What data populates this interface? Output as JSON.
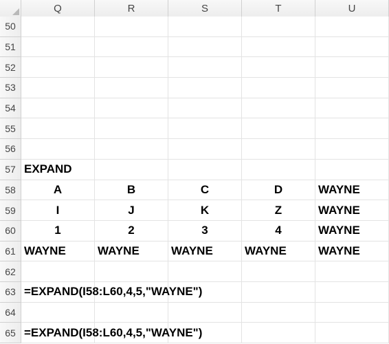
{
  "columns": [
    "Q",
    "R",
    "S",
    "T",
    "U"
  ],
  "row_start": 50,
  "row_end": 65,
  "row_height": 29.7,
  "chart_data": {
    "type": "table",
    "title": "",
    "cells": {
      "Q57": {
        "v": "EXPAND",
        "bold": true,
        "align": "left"
      },
      "Q58": {
        "v": "A",
        "bold": true,
        "align": "center"
      },
      "R58": {
        "v": "B",
        "bold": true,
        "align": "center"
      },
      "S58": {
        "v": "C",
        "bold": true,
        "align": "center"
      },
      "T58": {
        "v": "D",
        "bold": true,
        "align": "center"
      },
      "U58": {
        "v": "WAYNE",
        "bold": true,
        "align": "left"
      },
      "Q59": {
        "v": "I",
        "bold": true,
        "align": "center"
      },
      "R59": {
        "v": "J",
        "bold": true,
        "align": "center"
      },
      "S59": {
        "v": "K",
        "bold": true,
        "align": "center"
      },
      "T59": {
        "v": "Z",
        "bold": true,
        "align": "center"
      },
      "U59": {
        "v": "WAYNE",
        "bold": true,
        "align": "left"
      },
      "Q60": {
        "v": "1",
        "bold": true,
        "align": "center"
      },
      "R60": {
        "v": "2",
        "bold": true,
        "align": "center"
      },
      "S60": {
        "v": "3",
        "bold": true,
        "align": "center"
      },
      "T60": {
        "v": "4",
        "bold": true,
        "align": "center"
      },
      "U60": {
        "v": "WAYNE",
        "bold": true,
        "align": "left"
      },
      "Q61": {
        "v": "WAYNE",
        "bold": true,
        "align": "left"
      },
      "R61": {
        "v": "WAYNE",
        "bold": true,
        "align": "left"
      },
      "S61": {
        "v": "WAYNE",
        "bold": true,
        "align": "left"
      },
      "T61": {
        "v": "WAYNE",
        "bold": true,
        "align": "left"
      },
      "U61": {
        "v": "WAYNE",
        "bold": true,
        "align": "left"
      },
      "Q63": {
        "v": "=EXPAND(I58:L60,4,5,\"WAYNE\")",
        "bold": true,
        "align": "left",
        "span": 4
      },
      "Q65": {
        "v": "=EXPAND(I58:L60,4,5,\"WAYNE\")",
        "bold": true,
        "align": "left",
        "span": 4
      }
    }
  }
}
